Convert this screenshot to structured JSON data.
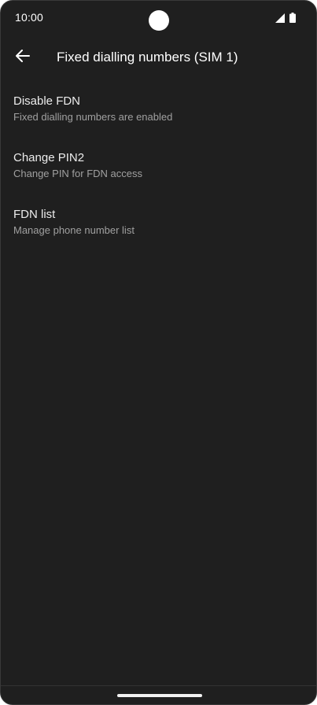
{
  "status_bar": {
    "time": "10:00",
    "icons": [
      "signal-icon",
      "battery-icon"
    ]
  },
  "app_bar": {
    "back_icon": "arrow-back-icon",
    "title": "Fixed dialling numbers (SIM 1)"
  },
  "preferences": [
    {
      "title": "Disable FDN",
      "summary": "Fixed dialling numbers are enabled"
    },
    {
      "title": "Change PIN2",
      "summary": "Change PIN for FDN access"
    },
    {
      "title": "FDN list",
      "summary": "Manage phone number list"
    }
  ],
  "colors": {
    "background": "#1f1f1f",
    "title_text": "#ececec",
    "summary_text": "#a0a0a0"
  }
}
